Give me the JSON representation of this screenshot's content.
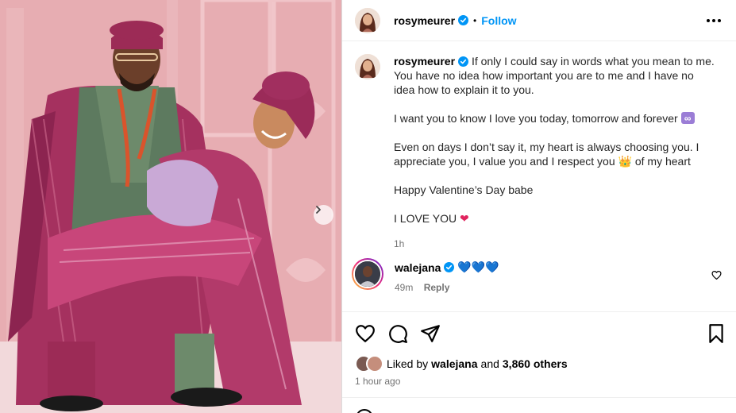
{
  "post": {
    "author": "rosymeurer",
    "follow_label": "Follow",
    "separator": "•"
  },
  "caption": {
    "username": "rosymeurer",
    "paragraph_1": "If only I could say in words what you mean to me. You have no idea how important you are to me and I have no idea how to explain it to you.",
    "paragraph_2": "I want you to know I love you today, tomorrow and forever",
    "paragraph_2_emoji": "∞",
    "paragraph_3a": "Even on days I don’t say it, my heart is always choosing you. I appreciate you, I value you and I respect you",
    "paragraph_3_emoji": "👑",
    "paragraph_3b": "of my heart",
    "paragraph_4": "Happy Valentine’s Day babe",
    "paragraph_5": "I LOVE YOU",
    "paragraph_5_emoji": "❤",
    "time": "1h"
  },
  "comment": {
    "username": "walejana",
    "text": "💙💙💙",
    "time": "49m",
    "reply_label": "Reply"
  },
  "likes": {
    "prefix": "Liked by",
    "user": "walejana",
    "middle": "and",
    "count": "3,860 others"
  },
  "posted": "1 hour ago",
  "icons": {
    "verified": "verified-badge-icon",
    "more": "more-options-icon",
    "like": "heart-icon",
    "comment": "comment-icon",
    "share": "share-icon",
    "save": "bookmark-icon",
    "next": "chevron-right-icon",
    "emoji": "smiley-icon"
  },
  "colors": {
    "accent": "#0095f6",
    "verified": "#0095f6",
    "muted": "#737373"
  }
}
